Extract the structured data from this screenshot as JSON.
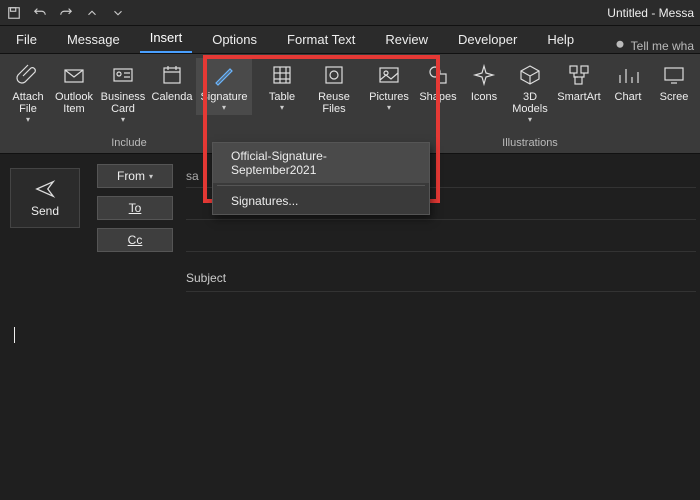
{
  "title": "Untitled  -  Messa",
  "qat_icons": [
    "save-icon",
    "undo-icon",
    "redo-icon",
    "up-icon",
    "down-icon"
  ],
  "tabs": {
    "file": "File",
    "message": "Message",
    "insert": "Insert",
    "options": "Options",
    "format_text": "Format Text",
    "review": "Review",
    "developer": "Developer",
    "help": "Help",
    "tell_me": "Tell me wha"
  },
  "ribbon": {
    "attach_file": "Attach\nFile",
    "outlook_item": "Outlook\nItem",
    "business_card": "Business\nCard",
    "calendar": "Calenda",
    "signature": "Signature",
    "table": "Table",
    "reuse_files": "Reuse\nFiles",
    "pictures": "Pictures",
    "shapes": "Shapes",
    "icons": "Icons",
    "models3d": "3D\nModels",
    "smartart": "SmartArt",
    "chart": "Chart",
    "screenshot": "Scree",
    "group_include": "Include",
    "group_illustrations": "Illustrations"
  },
  "signature_menu": {
    "item1": "Official-Signature-September2021",
    "item2": "Signatures..."
  },
  "compose": {
    "send": "Send",
    "from": "From",
    "to": "To",
    "cc": "Cc",
    "from_value": "sa",
    "subject_label": "Subject"
  }
}
